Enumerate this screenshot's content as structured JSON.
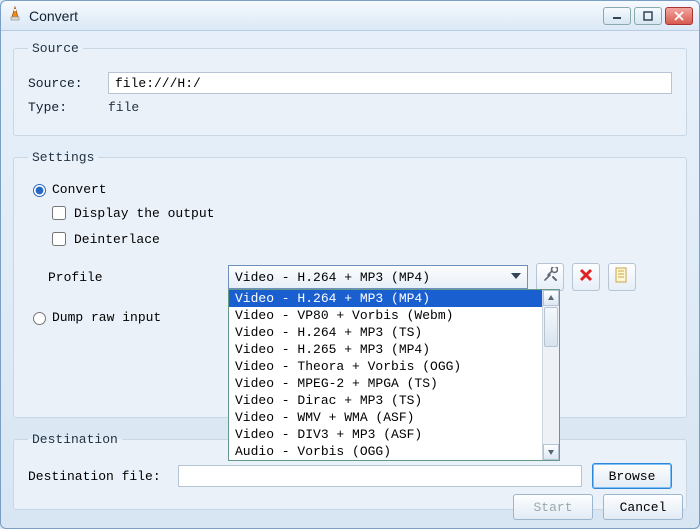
{
  "window": {
    "title": "Convert"
  },
  "source_group": {
    "legend": "Source",
    "source_label": "Source:",
    "source_value": "file:///H:/",
    "type_label": "Type:",
    "type_value": "file"
  },
  "settings_group": {
    "legend": "Settings",
    "convert_label": "Convert",
    "display_output_label": "Display the output",
    "deinterlace_label": "Deinterlace",
    "profile_label": "Profile",
    "profile_selected": "Video - H.264 + MP3 (MP4)",
    "profile_options": [
      "Video - H.264 + MP3 (MP4)",
      "Video - VP80 + Vorbis (Webm)",
      "Video - H.264 + MP3 (TS)",
      "Video - H.265 + MP3 (MP4)",
      "Video - Theora + Vorbis (OGG)",
      "Video - MPEG-2 + MPGA (TS)",
      "Video - Dirac + MP3 (TS)",
      "Video - WMV + WMA (ASF)",
      "Video - DIV3 + MP3 (ASF)",
      "Audio - Vorbis (OGG)"
    ],
    "dump_raw_label": "Dump raw input"
  },
  "dest_group": {
    "legend": "Destination",
    "dest_label": "Destination file:",
    "browse_label": "Browse"
  },
  "footer": {
    "start_label": "Start",
    "cancel_label": "Cancel"
  }
}
